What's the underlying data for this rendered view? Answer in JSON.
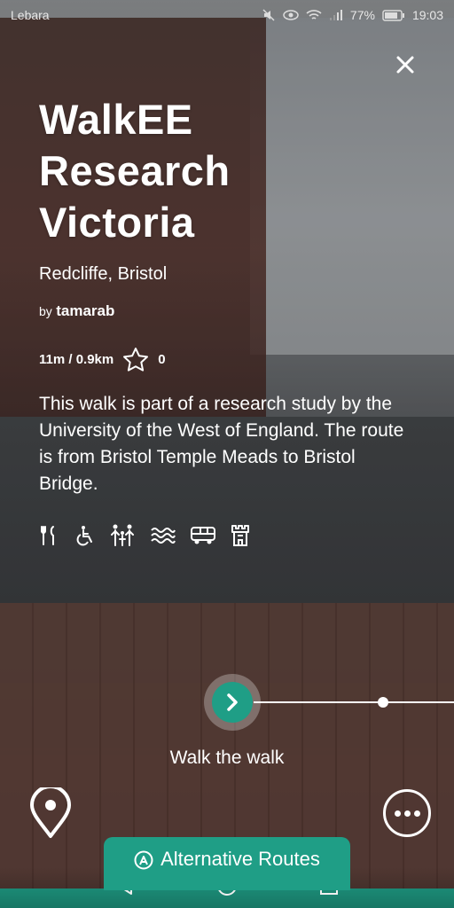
{
  "status_bar": {
    "carrier": "Lebara",
    "battery": "77%",
    "time": "19:03"
  },
  "walk": {
    "title_line1": "WalkEE",
    "title_line2": "Research",
    "title_line3": "Victoria",
    "location": "Redcliffe, Bristol",
    "by_label": "by",
    "author": "tamarab",
    "duration_distance": "11m / 0.9km",
    "rating_count": "0",
    "description": "This walk is part of a research study by the University of the West of England. The route is from Bristol Temple Meads to Bristol Bridge.",
    "amenities": [
      "food-icon",
      "wheelchair-icon",
      "family-icon",
      "water-icon",
      "bus-icon",
      "castle-icon"
    ]
  },
  "slider": {
    "label": "Walk the walk"
  },
  "bottom": {
    "alt_routes_label": "Alternative Routes"
  },
  "colors": {
    "accent": "#1f9e86",
    "text": "#ffffff"
  }
}
